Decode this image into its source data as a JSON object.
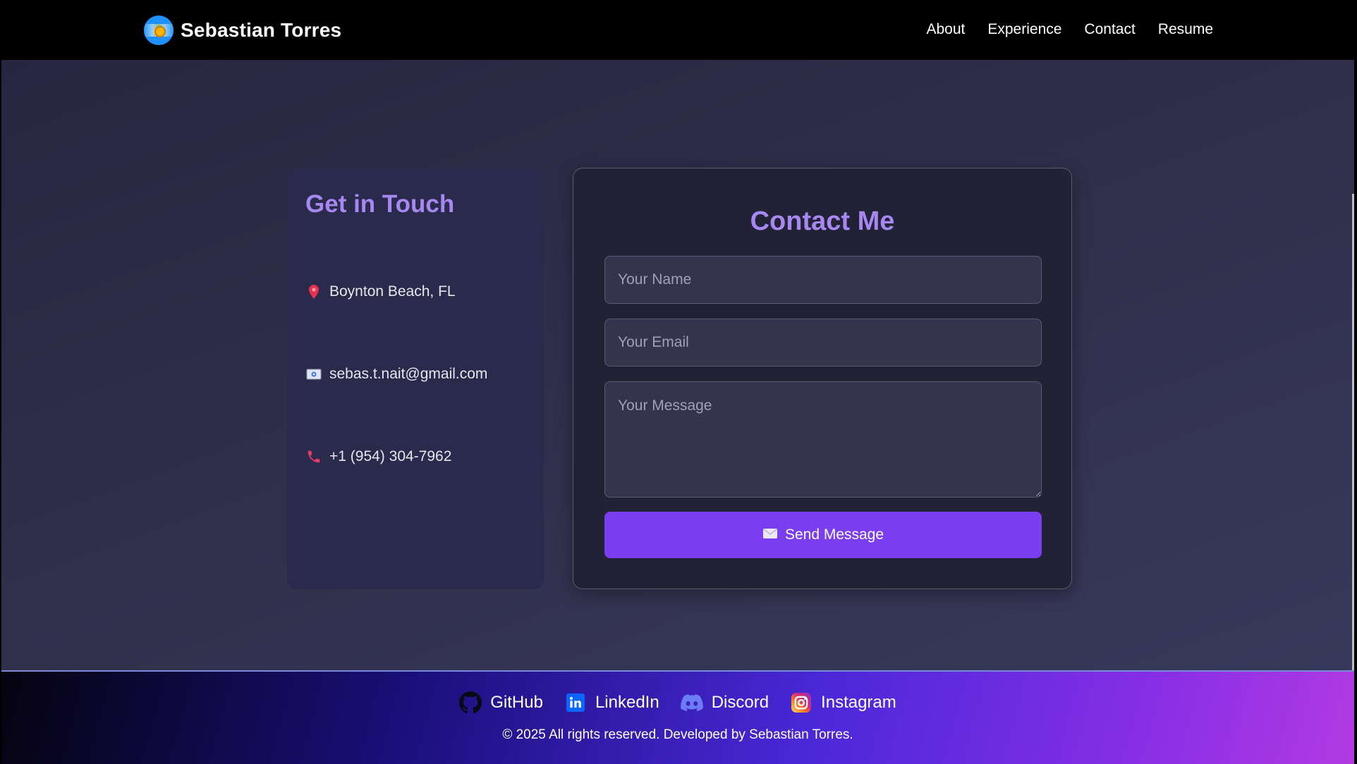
{
  "header": {
    "brand_name": "Sebastian Torres",
    "nav": [
      "About",
      "Experience",
      "Contact",
      "Resume"
    ]
  },
  "info": {
    "title": "Get in Touch",
    "location": "Boynton Beach, FL",
    "email": "sebas.t.nait@gmail.com",
    "phone": "+1 (954) 304-7962"
  },
  "form": {
    "title": "Contact Me",
    "name_placeholder": "Your Name",
    "email_placeholder": "Your Email",
    "message_placeholder": "Your Message",
    "send_label": "Send Message"
  },
  "footer": {
    "socials": [
      "GitHub",
      "LinkedIn",
      "Discord",
      "Instagram"
    ],
    "copyright": "© 2025 All rights reserved. Developed by Sebastian Torres."
  },
  "colors": {
    "accent": "#a688f0",
    "button": "#7b3df0",
    "card": "#2a2a4c"
  }
}
